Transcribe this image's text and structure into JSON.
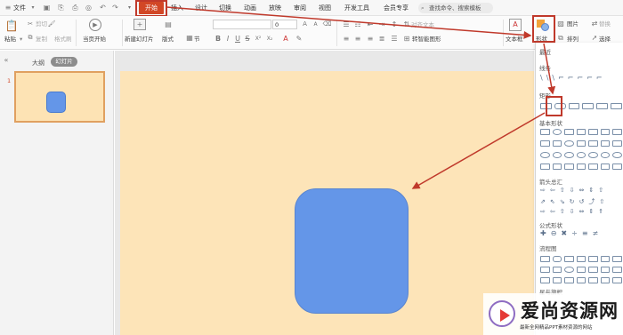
{
  "menubar": {
    "file_menu": "文件",
    "tabs": [
      "开始",
      "插入",
      "设计",
      "切换",
      "动画",
      "放映",
      "审阅",
      "视图",
      "开发工具",
      "会员专享"
    ],
    "active_tab": "开始",
    "search_placeholder": "查找命令、搜索模板"
  },
  "ribbon": {
    "paste": "粘贴",
    "cut": "剪切",
    "copy": "复制",
    "format_painter": "格式刷",
    "play_from_current": "当页开始",
    "new_slide": "新建幻灯片",
    "layout": "版式",
    "section": "节",
    "font_size": "0",
    "convert_smartart": "转智能图形",
    "text_box": "文本框",
    "shapes": "形状",
    "picture": "图片",
    "arrange": "排列",
    "replace": "替换",
    "select": "选择",
    "text_direction": "对齐文本"
  },
  "left_panel": {
    "tab_outline": "大纲",
    "tab_slides": "幻灯片",
    "slide_number": "1"
  },
  "shape_panel": {
    "recent": "最近",
    "lines": "线条",
    "rectangles": "矩形",
    "basic_shapes": "基本形状",
    "block_arrows": "箭头总汇",
    "equation_shapes": "公式形状",
    "flowchart": "流程图",
    "stars_banners": "星与旗帜"
  },
  "colors": {
    "accent": "#d24726",
    "highlight": "#c0392b",
    "slide_bg": "#fde4b8",
    "shape_fill": "#6496e8"
  },
  "watermark": {
    "title": "爱尚资源网",
    "subtitle": "最新全网精品PPT素材资源的网站"
  }
}
